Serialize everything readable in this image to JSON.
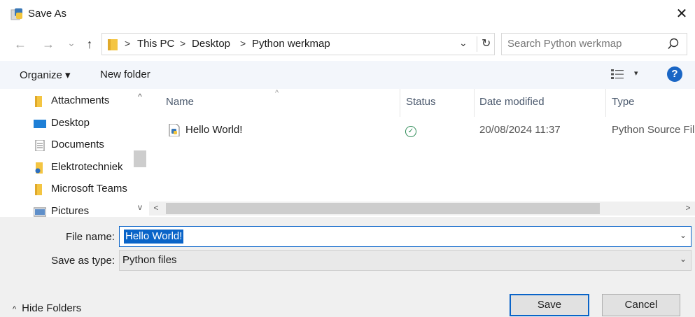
{
  "window": {
    "title": "Save As",
    "close_glyph": "✕"
  },
  "nav": {
    "back": "←",
    "forward": "→",
    "recent": "⌄",
    "up": "↑"
  },
  "address": {
    "crumbs": [
      "This PC",
      "Desktop",
      "Python werkmap"
    ],
    "separator": ">",
    "dropdown": "⌄",
    "refresh": "↻"
  },
  "search": {
    "placeholder": "Search Python werkmap"
  },
  "toolbar": {
    "organize": "Organize ▾",
    "new_folder": "New folder",
    "view_drop": "▾",
    "help": "?"
  },
  "sidebar": {
    "items": [
      {
        "label": "Attachments",
        "icon": "folder-icon"
      },
      {
        "label": "Desktop",
        "icon": "desktop-icon"
      },
      {
        "label": "Documents",
        "icon": "documents-icon"
      },
      {
        "label": "Elektrotechniek",
        "icon": "shared-folder-icon"
      },
      {
        "label": "Microsoft Teams",
        "icon": "folder-icon"
      },
      {
        "label": "Pictures",
        "icon": "pictures-icon"
      }
    ],
    "scroll_up": "^",
    "scroll_down": "v"
  },
  "filelist": {
    "columns": [
      "Name",
      "Status",
      "Date modified",
      "Type"
    ],
    "sort_caret": "^",
    "rows": [
      {
        "name": "Hello World!",
        "status": "✓",
        "date": "20/08/2024 11:37",
        "type": "Python Source Fil"
      }
    ],
    "scroll_left": "<",
    "scroll_right": ">"
  },
  "form": {
    "file_name_label": "File name:",
    "file_name_value": "Hello World!",
    "save_as_type_label": "Save as type:",
    "save_as_type_value": "Python files",
    "dd_glyph": "⌄"
  },
  "buttons": {
    "save": "Save",
    "cancel": "Cancel"
  },
  "footer": {
    "hide_folders": "Hide Folders",
    "caret": "^"
  },
  "colors": {
    "accent": "#0a64c8",
    "toolbar_bg": "#f3f6fb",
    "panel_bg": "#f0f0f0",
    "status_green": "#2e8b57",
    "folder_yellow": "#f4c542"
  }
}
